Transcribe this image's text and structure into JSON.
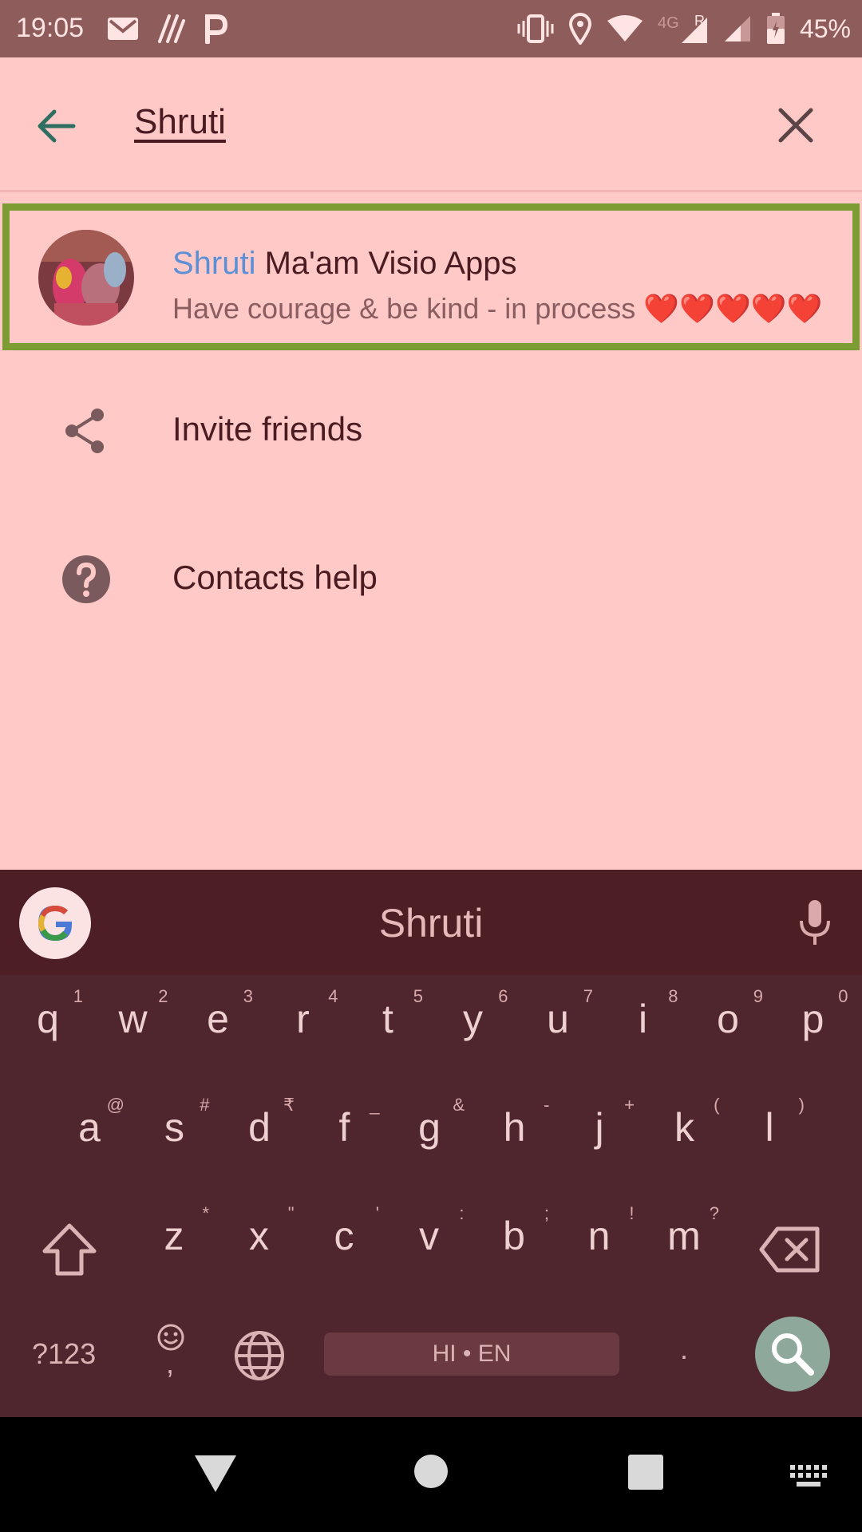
{
  "status_bar": {
    "time": "19:05",
    "network_type": "4G",
    "roaming_indicator": "R",
    "battery": "45%",
    "icons": [
      "gmail-icon",
      "app-icon",
      "paytm-icon",
      "vibrate-icon",
      "location-icon",
      "wifi-icon",
      "signal-icon",
      "battery-icon"
    ]
  },
  "search": {
    "query": "Shruti"
  },
  "result": {
    "name_highlight": "Shruti",
    "name_rest": " Ma'am Visio Apps",
    "status": "Have courage & be kind - in process ❤️❤️❤️❤️❤️"
  },
  "menu": {
    "invite": "Invite friends",
    "help": "Contacts help"
  },
  "keyboard": {
    "suggestion": "Shruti",
    "row1": [
      {
        "ch": "q",
        "sup": "1"
      },
      {
        "ch": "w",
        "sup": "2"
      },
      {
        "ch": "e",
        "sup": "3"
      },
      {
        "ch": "r",
        "sup": "4"
      },
      {
        "ch": "t",
        "sup": "5"
      },
      {
        "ch": "y",
        "sup": "6"
      },
      {
        "ch": "u",
        "sup": "7"
      },
      {
        "ch": "i",
        "sup": "8"
      },
      {
        "ch": "o",
        "sup": "9"
      },
      {
        "ch": "p",
        "sup": "0"
      }
    ],
    "row2": [
      {
        "ch": "a",
        "sup": "@"
      },
      {
        "ch": "s",
        "sup": "#"
      },
      {
        "ch": "d",
        "sup": "₹"
      },
      {
        "ch": "f",
        "sup": "_"
      },
      {
        "ch": "g",
        "sup": "&"
      },
      {
        "ch": "h",
        "sup": "-"
      },
      {
        "ch": "j",
        "sup": "+"
      },
      {
        "ch": "k",
        "sup": "("
      },
      {
        "ch": "l",
        "sup": ")"
      }
    ],
    "row3": [
      {
        "ch": "z",
        "sup": "*"
      },
      {
        "ch": "x",
        "sup": "\""
      },
      {
        "ch": "c",
        "sup": "'"
      },
      {
        "ch": "v",
        "sup": ":"
      },
      {
        "ch": "b",
        "sup": ";"
      },
      {
        "ch": "n",
        "sup": "!"
      },
      {
        "ch": "m",
        "sup": "?"
      }
    ],
    "symbols_label": "?123",
    "space_label": "HI • EN",
    "period": ".",
    "comma": ","
  },
  "colors": {
    "accent_highlight": "#5b8fd6",
    "selection_border": "#7d9c33",
    "keyboard_bg": "#4f262d"
  }
}
